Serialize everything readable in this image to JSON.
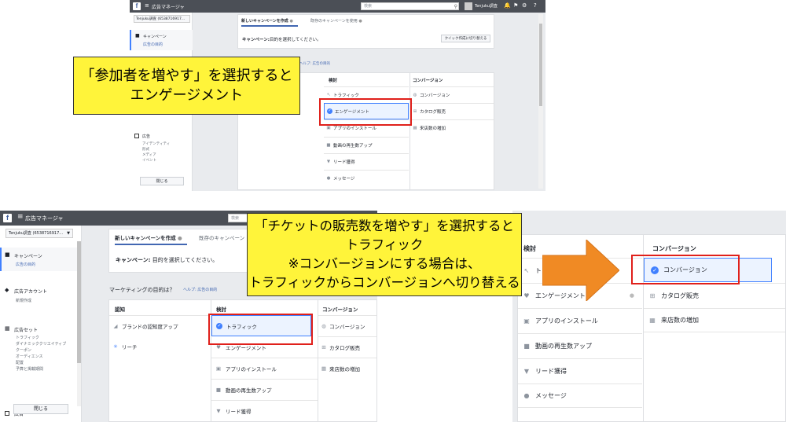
{
  "top_screen": {
    "app_title": "広告マネージャ",
    "search_placeholder": "検索",
    "user_name": "Tenjuku調査",
    "account_select": "Tenjuku調査 (6538716917...",
    "nav": {
      "campaign": "キャンペーン",
      "campaign_sub": "広告の目的",
      "ad": "広告",
      "ad_subs": [
        "アイデンティティ",
        "形式",
        "メディア",
        "イベント"
      ]
    },
    "close_button": "閉じる",
    "tabs": {
      "new": "新しいキャンペーンを作成",
      "existing": "既存のキャンペーンを使用"
    },
    "campaign_prompt_label": "キャンペーン:",
    "campaign_prompt_text": "目的を選択してください。",
    "quick_create_button": "クイック作成に切り替える",
    "objective_help": "ヘルプ: 広告の目的",
    "columns": {
      "consideration": "検討",
      "conversion": "コンバージョン"
    },
    "consideration_items": [
      "トラフィック",
      "エンゲージメント",
      "アプリのインストール",
      "動画の再生数アップ",
      "リード獲得",
      "メッセージ"
    ],
    "conversion_items": [
      "コンバージョン",
      "カタログ販売",
      "来店数の増加"
    ],
    "callout_lines": [
      "「参加者を増やす」を選択すると",
      "エンゲージメント"
    ]
  },
  "bottom_left_screen": {
    "app_title": "広告マネージャ",
    "search_placeholder": "検索",
    "account_select": "Tenjuku調査 (6538716917...",
    "nav": {
      "campaign": "キャンペーン",
      "campaign_sub": "広告の目的",
      "account": "広告アカウント",
      "account_sub": "新規作成",
      "adset": "広告セット",
      "adset_subs": [
        "トラフィック",
        "ダイナミッククリエイティブ",
        "クーポン",
        "オーディエンス",
        "配置",
        "予算と掲載期間"
      ],
      "ad": "広告"
    },
    "close_button": "閉じる",
    "tabs": {
      "new": "新しいキャンペーンを作成",
      "existing": "既存のキャンペーン"
    },
    "campaign_prompt_label": "キャンペーン:",
    "campaign_prompt_text": "目的を選択してください。",
    "objective_question": "マーケティングの目的は？",
    "objective_help": "ヘルプ: 広告の目的",
    "columns": {
      "awareness": "認知",
      "consideration": "検討",
      "conversion": "コンバージョン"
    },
    "awareness_items": [
      "ブランドの認知度アップ",
      "リーチ"
    ],
    "consideration_items": [
      "トラフィック",
      "エンゲージメント",
      "アプリのインストール",
      "動画の再生数アップ",
      "リード獲得"
    ],
    "conversion_items": [
      "コンバージョン",
      "カタログ販売",
      "来店数の増加"
    ]
  },
  "bottom_right_screen": {
    "columns": {
      "consideration": "検討",
      "conversion": "コンバージョン"
    },
    "consideration_items": [
      "トラフィック",
      "エンゲージメント",
      "アプリのインストール",
      "動画の再生数アップ",
      "リード獲得",
      "メッセージ"
    ],
    "conversion_items": [
      "コンバージョン",
      "カタログ販売",
      "来店数の増加"
    ]
  },
  "callout2_lines": [
    "「チケットの販売数を増やす」を選択すると",
    "トラフィック",
    "※コンバージョンにする場合は、",
    "トラフィックからコンバージョンへ切り替える"
  ],
  "colors": {
    "callout": "#fff43a",
    "highlight": "#e0201b",
    "arrow": "#f08a24",
    "fb_bar": "#4b4f56",
    "selected_bg": "#ecf3ff",
    "accent": "#4080ff"
  }
}
